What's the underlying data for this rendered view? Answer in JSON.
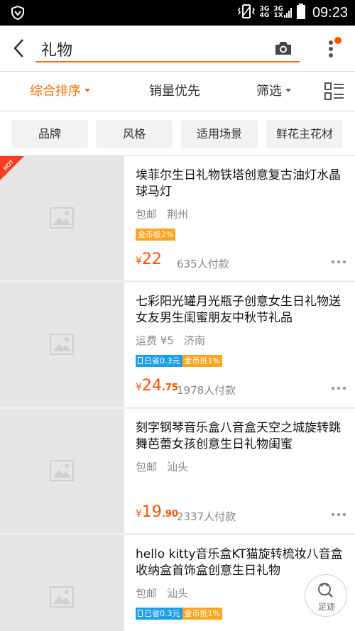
{
  "status_bar": {
    "time": "09:23",
    "net1_top": "3G",
    "net1_bottom": "4G",
    "net2_top": "3G",
    "net2_bottom": "1X"
  },
  "search": {
    "query": "礼物"
  },
  "sort": {
    "comprehensive": "综合排序",
    "sales": "销量优先",
    "filter": "筛选"
  },
  "filters": [
    "品牌",
    "风格",
    "适用场景",
    "鲜花主花材"
  ],
  "hot_badge": "HOT",
  "products": [
    {
      "title": "埃菲尔生日礼物铁塔创意复古油灯水晶球马灯",
      "shipping": "包邮",
      "location": "荆州",
      "tags": [
        {
          "text": "金币抵2%",
          "color": "orange"
        }
      ],
      "price_yen": "¥",
      "price_int": "22",
      "price_dec": "",
      "sales": "635人付款"
    },
    {
      "title": "七彩阳光罐月光瓶子创意女生日礼物送女友男生闺蜜朋友中秋节礼品",
      "shipping": "运费 ¥5",
      "location": "济南",
      "tags": [
        {
          "text": "已省0.3元",
          "color": "blue",
          "icon": "phone-icon"
        },
        {
          "text": "金币抵1%",
          "color": "orange"
        }
      ],
      "price_yen": "¥",
      "price_int": "24",
      "price_dec": ".75",
      "sales": "1978人付款"
    },
    {
      "title": "刻字钢琴音乐盒八音盒天空之城旋转跳舞芭蕾女孩创意生日礼物闺蜜",
      "shipping": "包邮",
      "location": "汕头",
      "tags": [],
      "price_yen": "¥",
      "price_int": "19",
      "price_dec": ".90",
      "sales": "2337人付款"
    },
    {
      "title": "hello kitty音乐盒KT猫旋转梳妆八音盒收纳盒首饰盒创意生日礼物",
      "shipping": "包邮",
      "location": "汕头",
      "tags": [
        {
          "text": "已省0.3元",
          "color": "blue",
          "icon": "phone-icon"
        },
        {
          "text": "金币抵1%",
          "color": "orange"
        }
      ],
      "price_yen": "",
      "price_int": "",
      "price_dec": "",
      "sales": ""
    }
  ],
  "footprint": {
    "label": "足迹"
  },
  "colors": {
    "accent": "#ff6a00",
    "price": "#ff5000",
    "tag_blue": "#1ea0e8",
    "tag_orange": "#ffa51f"
  }
}
